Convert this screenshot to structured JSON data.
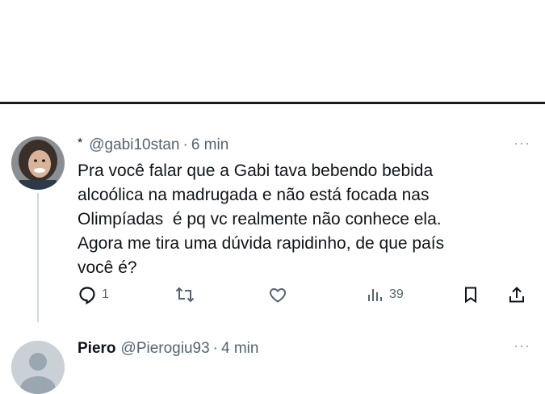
{
  "tweets": [
    {
      "prefix": "*",
      "display_name": "",
      "handle": "@gabi10stan",
      "separator": "·",
      "time": "6 min",
      "more": "···",
      "lines": [
        "Pra você falar que a Gabi tava bebendo bebida",
        "alcoólica na madrugada e não está focada nas",
        "Olimpíadas  é pq vc realmente não conhece ela.",
        "Agora me tira uma dúvida rapidinho, de que país",
        "você é?"
      ],
      "actions": {
        "reply_count": "1",
        "retweet_count": "",
        "like_count": "",
        "views_count": "39"
      }
    },
    {
      "display_name": "Piero",
      "handle": "@Pierogiu93",
      "separator": "·",
      "time": "4 min",
      "more": "···"
    }
  ],
  "icons": {
    "reply": "reply-icon",
    "retweet": "retweet-icon",
    "like": "heart-icon",
    "views": "views-icon",
    "bookmark": "bookmark-icon",
    "share": "share-icon",
    "more": "more-icon"
  },
  "colors": {
    "text": "#0f1419",
    "muted": "#536471",
    "divider": "#1a1a1a",
    "thread_line": "#cfd9de"
  }
}
